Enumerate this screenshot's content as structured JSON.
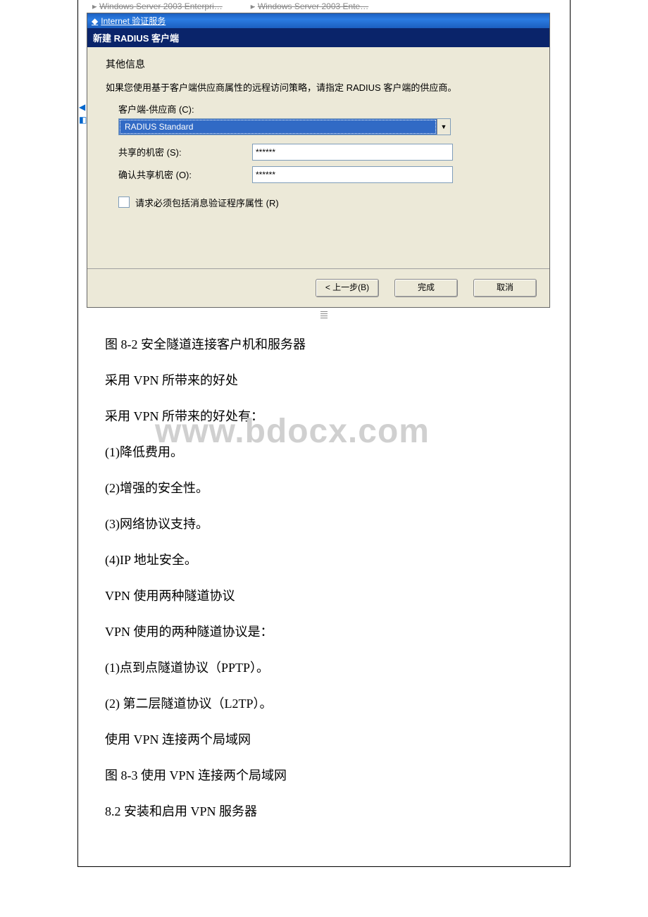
{
  "taskbar": {
    "item1": "Windows Server 2003 Enterpri…",
    "item2": "Windows Server 2003 Ente…"
  },
  "dialog": {
    "parent_title": "Internet 验证服务",
    "title": "新建 RADIUS 客户端",
    "section": "其他信息",
    "help": "如果您使用基于客户端供应商属性的远程访问策略，请指定 RADIUS 客户端的供应商。",
    "vendor_label": "客户端-供应商 (C):",
    "vendor_value": "RADIUS Standard",
    "secret_label": "共享的机密 (S):",
    "secret_value": "******",
    "confirm_label": "确认共享机密 (O):",
    "confirm_value": "******",
    "checkbox_label": "请求必须包括消息验证程序属性 (R)",
    "btn_back": "< 上一步(B)",
    "btn_finish": "完成",
    "btn_cancel": "取消"
  },
  "watermark": "www.bdocx.com",
  "body": {
    "p1": "图 8-2 安全隧道连接客户机和服务器",
    "p2": "采用 VPN 所带来的好处",
    "p3": "采用 VPN 所带来的好处有：",
    "p4": "(1)降低费用。",
    "p5": "(2)增强的安全性。",
    "p6": "(3)网络协议支持。",
    "p7": "(4)IP 地址安全。",
    "p8": "VPN 使用两种隧道协议",
    "p9": "VPN 使用的两种隧道协议是：",
    "p10": "(1)点到点隧道协议（PPTP）。",
    "p11": "(2) 第二层隧道协议（L2TP）。",
    "p12": "使用 VPN 连接两个局域网",
    "p13": "图 8-3 使用 VPN 连接两个局域网",
    "p14": "8.2 安装和启用 VPN 服务器"
  }
}
